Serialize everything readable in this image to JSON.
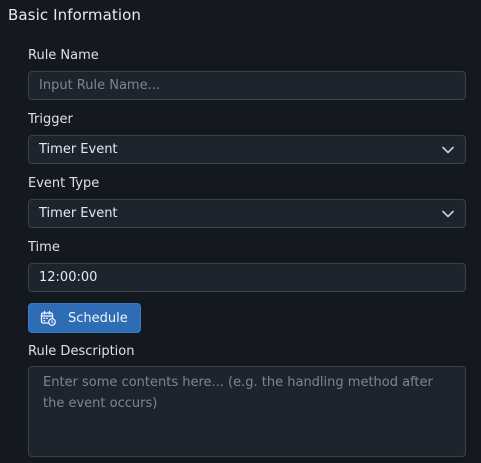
{
  "section": {
    "title": "Basic Information"
  },
  "rule_name": {
    "label": "Rule Name",
    "value": "",
    "placeholder": "Input Rule Name..."
  },
  "trigger": {
    "label": "Trigger",
    "selected": "Timer Event"
  },
  "event_type": {
    "label": "Event Type",
    "selected": "Timer Event"
  },
  "time": {
    "label": "Time",
    "value": "12:00:00"
  },
  "schedule_button": {
    "label": "Schedule",
    "icon": "calendar-clock-icon"
  },
  "rule_description": {
    "label": "Rule Description",
    "value": "",
    "placeholder": "Enter some contents here... (e.g. the handling method after the event occurs)"
  },
  "colors": {
    "background": "#14181f",
    "input_background": "#1e242d",
    "input_border": "#3a414c",
    "accent": "#2e6db6"
  }
}
